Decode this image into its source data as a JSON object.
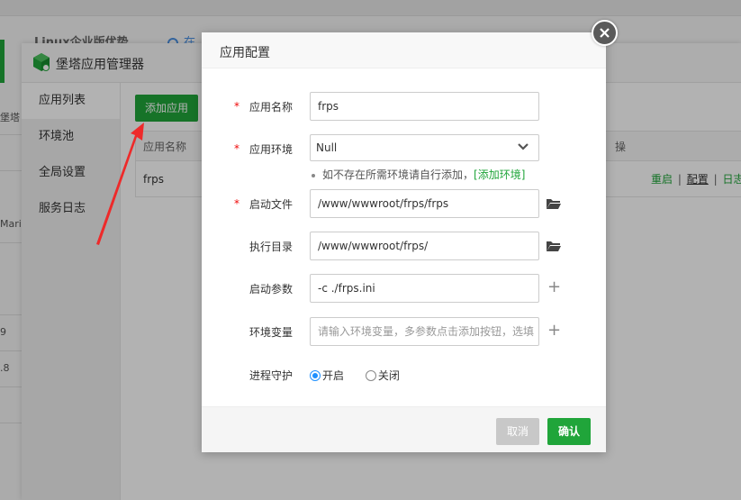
{
  "background": {
    "header_title": "Linux企业版优势",
    "header_link": "在",
    "left_cells": [
      "堡塔",
      "",
      "Mari",
      "",
      "9",
      ".8",
      ""
    ]
  },
  "window": {
    "title": "堡塔应用管理器",
    "sidebar": [
      {
        "label": "应用列表",
        "active": true
      },
      {
        "label": "环境池",
        "active": false
      },
      {
        "label": "全局设置",
        "active": false
      },
      {
        "label": "服务日志",
        "active": false
      }
    ],
    "add_button": "添加应用",
    "table": {
      "headers": {
        "name": "应用名称",
        "operations": "操"
      },
      "rows": [
        {
          "name": "frps",
          "actions": [
            "重启",
            "配置",
            "日志"
          ],
          "sep": "|"
        }
      ]
    }
  },
  "modal": {
    "title": "应用配置",
    "fields": {
      "app_name": {
        "label": "应用名称",
        "required": "*",
        "value": "frps"
      },
      "app_env": {
        "label": "应用环境",
        "required": "*",
        "value": "Null"
      },
      "env_hint": {
        "text": "如不存在所需环境请自行添加，",
        "link": "[添加环境]"
      },
      "start_file": {
        "label": "启动文件",
        "required": "*",
        "value": "/www/wwwroot/frps/frps"
      },
      "work_dir": {
        "label": "执行目录",
        "value": "/www/wwwroot/frps/"
      },
      "start_args": {
        "label": "启动参数",
        "value": "-c ./frps.ini",
        "add": "+"
      },
      "env_vars": {
        "label": "环境变量",
        "placeholder": "请输入环境变量，多参数点击添加按钮，选填",
        "add": "+"
      },
      "daemon": {
        "label": "进程守护",
        "on_label": "开启",
        "off_label": "关闭",
        "selected": "开启"
      }
    },
    "buttons": {
      "cancel": "取消",
      "confirm": "确认"
    }
  },
  "colors": {
    "accent": "#20a53a",
    "required": "#ef0808",
    "radio": "#1e90ff",
    "arrow": "#ee2a2a"
  }
}
